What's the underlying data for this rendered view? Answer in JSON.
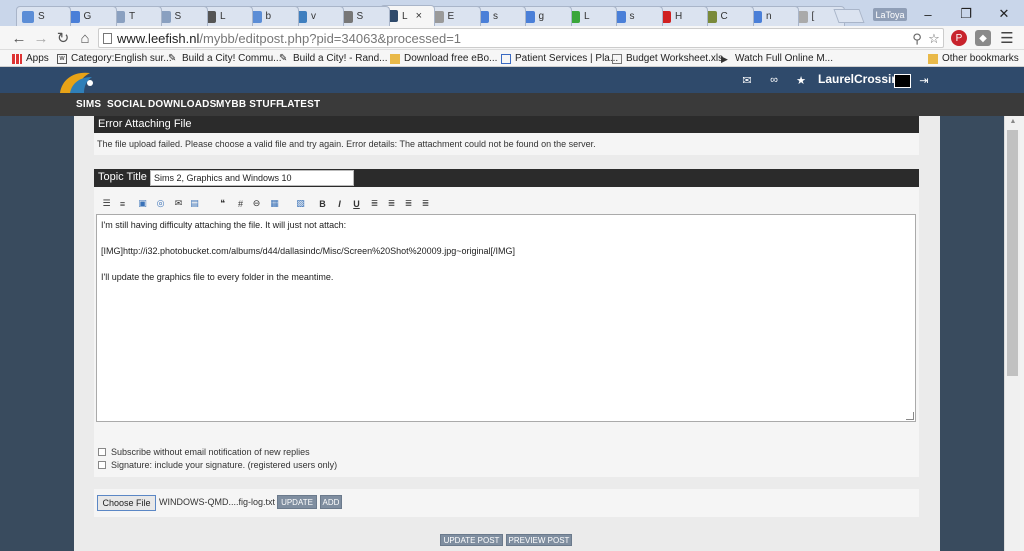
{
  "browser": {
    "tabs": [
      {
        "title": "S",
        "color": "#5b8dd6"
      },
      {
        "title": "G",
        "color": "#4a7fd8"
      },
      {
        "title": "T",
        "color": "#8aa0c0"
      },
      {
        "title": "S",
        "color": "#8aa0c0"
      },
      {
        "title": "L",
        "color": "#555555"
      },
      {
        "title": "b",
        "color": "#5b8dd6"
      },
      {
        "title": "v",
        "color": "#3f7fbf"
      },
      {
        "title": "S",
        "color": "#777777"
      },
      {
        "title": "L",
        "color": "#2f4a6b",
        "active": true
      },
      {
        "title": "E",
        "color": "#9a9a9a"
      },
      {
        "title": "s",
        "color": "#4a7fd8"
      },
      {
        "title": "g",
        "color": "#4a7fd8"
      },
      {
        "title": "L",
        "color": "#3aa63a"
      },
      {
        "title": "s",
        "color": "#4a7fd8"
      },
      {
        "title": "H",
        "color": "#d02020"
      },
      {
        "title": "C",
        "color": "#7a8a3a"
      },
      {
        "title": "n",
        "color": "#4a7fd8"
      },
      {
        "title": "[",
        "color": "#aaaaaa"
      }
    ],
    "profile_name": "LaToya",
    "url_host": "www.leefish.nl",
    "url_path": "/mybb/editpost.php?pid=34063&processed=1",
    "bookmarks": [
      {
        "label": "Apps",
        "icon": "apps-icon"
      },
      {
        "label": "Category:English sur...",
        "icon": "wiki-icon"
      },
      {
        "label": "Build a City! Commu...",
        "icon": "pin-icon"
      },
      {
        "label": "Build a City! - Rand...",
        "icon": "pin-icon"
      },
      {
        "label": "Download free eBo...",
        "icon": "folder-icon"
      },
      {
        "label": "Patient Services | Pla...",
        "icon": "site-icon"
      },
      {
        "label": "Budget Worksheet.xls",
        "icon": "page-icon"
      },
      {
        "label": "Watch Full Online M...",
        "icon": "video-icon"
      }
    ],
    "other_bookmarks": "Other bookmarks"
  },
  "site": {
    "username": "LaurelCrossing",
    "nav": [
      "SIMS",
      "SOCIAL",
      "DOWNLOADS",
      "MYBB STUFF",
      "LATEST"
    ]
  },
  "error": {
    "title": "Error Attaching File",
    "message": "The file upload failed. Please choose a valid file and try again. Error details: The attachment could not be found on the server."
  },
  "topic": {
    "label": "Topic Title",
    "value": "Sims 2, Graphics and Windows 10"
  },
  "editor": {
    "toolbar": [
      {
        "name": "ordered-list-icon",
        "glyph": "☰"
      },
      {
        "name": "unordered-list-icon",
        "glyph": "≡"
      },
      {
        "name": "image-icon",
        "glyph": "▣"
      },
      {
        "name": "globe-link-icon",
        "glyph": "◎"
      },
      {
        "name": "email-icon",
        "glyph": "✉"
      },
      {
        "name": "insert-image-icon",
        "glyph": "▤"
      },
      {
        "name": "quote-icon",
        "glyph": "❝"
      },
      {
        "name": "hash-icon",
        "glyph": "#"
      },
      {
        "name": "spoiler-icon",
        "glyph": "⊖"
      },
      {
        "name": "media-icon",
        "glyph": "▦"
      },
      {
        "name": "picture-icon",
        "glyph": "▧"
      },
      {
        "name": "bold-icon",
        "glyph": "B"
      },
      {
        "name": "italic-icon",
        "glyph": "I"
      },
      {
        "name": "underline-icon",
        "glyph": "U"
      },
      {
        "name": "align-left-icon",
        "glyph": "≣"
      },
      {
        "name": "align-center-icon",
        "glyph": "≣"
      },
      {
        "name": "align-right-icon",
        "glyph": "≣"
      },
      {
        "name": "justify-icon",
        "glyph": "≣"
      }
    ],
    "paragraphs": [
      "I'm still having difficulty attaching the file. It will just not attach:",
      "[IMG]http://i32.photobucket.com/albums/d44/dallasindc/Misc/Screen%20Shot%20009.jpg~original[/IMG]",
      "I'll update the graphics file to every folder in the meantime."
    ]
  },
  "options": [
    "Subscribe without email notification of new replies",
    "Signature: include your signature. (registered users only)"
  ],
  "upload": {
    "choose_label": "Choose File",
    "file_name": "WINDOWS-QMD....fig-log.txt",
    "update_label": "UPDATE",
    "add_label": "ADD"
  },
  "actions": {
    "update_post": "UPDATE POST",
    "preview_post": "PREVIEW POST"
  },
  "colors": {
    "header": "#2f4a6b",
    "nav": "#3a3a3a",
    "panel_head": "#2b2b2b",
    "button": "#7f8ea0"
  }
}
